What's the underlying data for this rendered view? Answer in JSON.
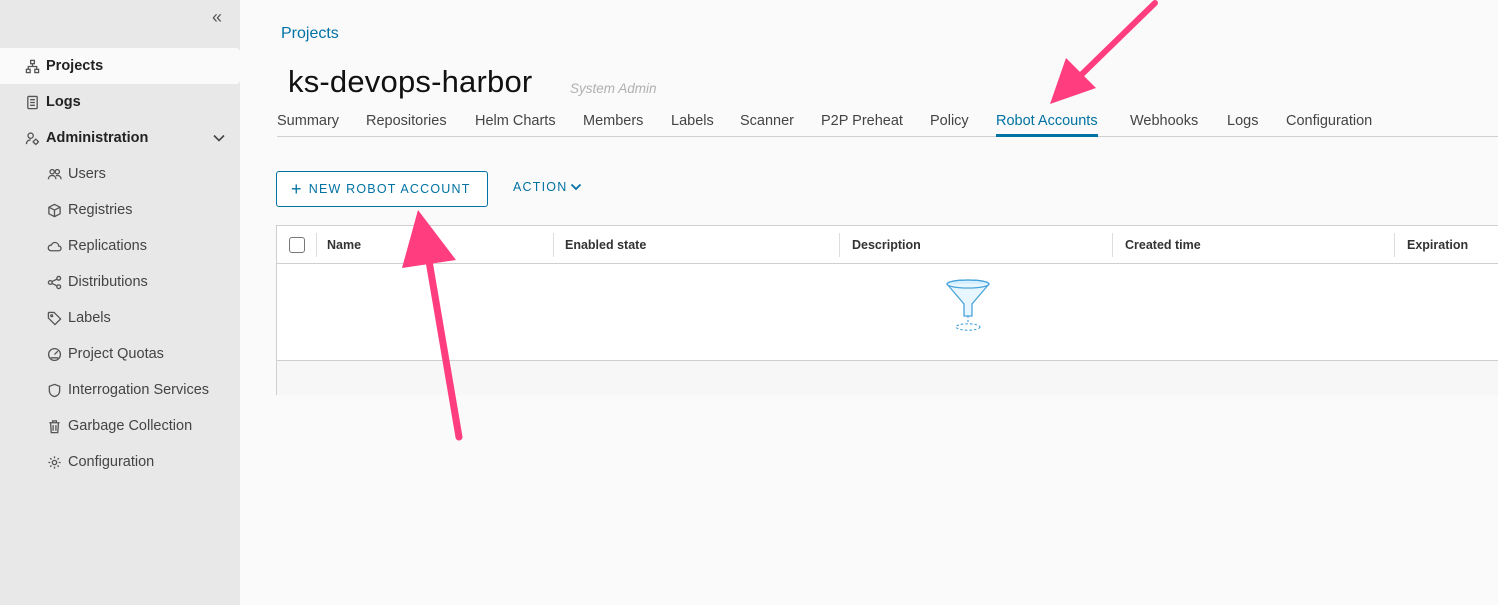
{
  "sidebar": {
    "items": [
      {
        "label": "Projects",
        "icon": "projects-icon"
      },
      {
        "label": "Logs",
        "icon": "logs-icon"
      },
      {
        "label": "Administration",
        "icon": "administration-icon"
      }
    ],
    "admin_items": [
      {
        "label": "Users",
        "icon": "users-icon"
      },
      {
        "label": "Registries",
        "icon": "registries-icon"
      },
      {
        "label": "Replications",
        "icon": "replications-icon"
      },
      {
        "label": "Distributions",
        "icon": "distributions-icon"
      },
      {
        "label": "Labels",
        "icon": "labels-icon"
      },
      {
        "label": "Project Quotas",
        "icon": "quotas-icon"
      },
      {
        "label": "Interrogation Services",
        "icon": "shield-icon"
      },
      {
        "label": "Garbage Collection",
        "icon": "trash-icon"
      },
      {
        "label": "Configuration",
        "icon": "gear-icon"
      }
    ]
  },
  "breadcrumb": "Projects",
  "project": {
    "name": "ks-devops-harbor",
    "role": "System Admin"
  },
  "tabs": [
    "Summary",
    "Repositories",
    "Helm Charts",
    "Members",
    "Labels",
    "Scanner",
    "P2P Preheat",
    "Policy",
    "Robot Accounts",
    "Webhooks",
    "Logs",
    "Configuration"
  ],
  "active_tab": "Robot Accounts",
  "toolbar": {
    "new_label": "NEW ROBOT ACCOUNT",
    "action_label": "ACTION"
  },
  "grid": {
    "columns": [
      "Name",
      "Enabled state",
      "Description",
      "Created time",
      "Expiration"
    ]
  },
  "colors": {
    "accent": "#0072a3",
    "annotation": "#ff3d7f"
  }
}
